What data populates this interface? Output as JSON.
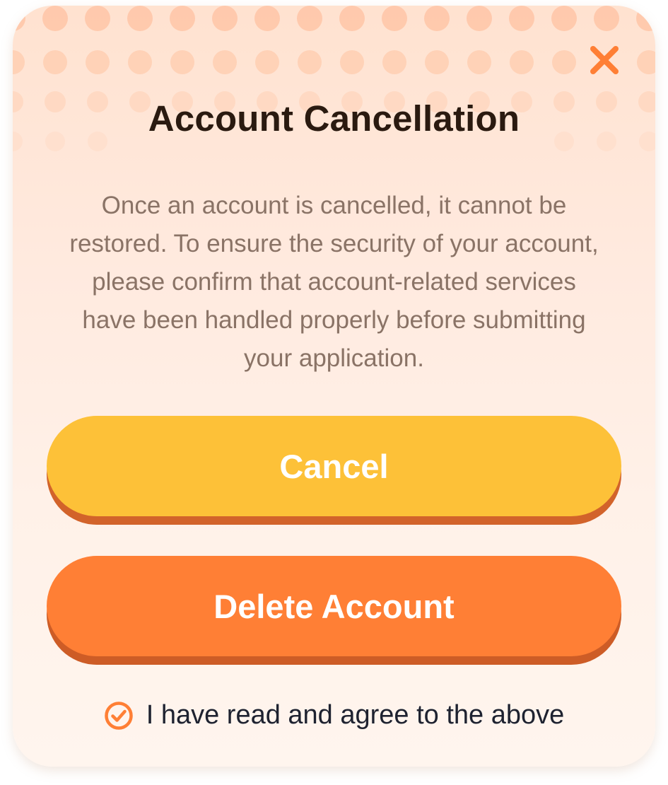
{
  "dialog": {
    "title": "Account Cancellation",
    "description": "Once an account is cancelled, it cannot be restored. To ensure the security of your account, please confirm that account-related services have been handled properly before submitting your application.",
    "close_icon": "close-icon",
    "cancel_label": "Cancel",
    "delete_label": "Delete Account",
    "agreement_label": "I have read and agree to the above",
    "agreement_checked": true,
    "check_icon": "check-circle-icon"
  },
  "colors": {
    "accent_orange": "#FF7F35",
    "cancel_yellow": "#FDC138",
    "title_text": "#2A1A10",
    "body_text": "#8A7366",
    "dots": "#FFC7A8"
  }
}
